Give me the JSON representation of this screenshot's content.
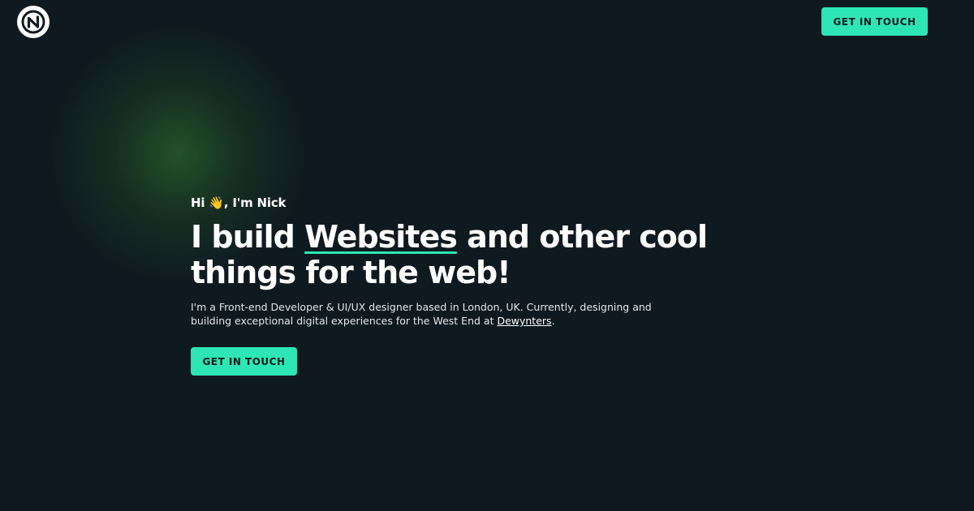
{
  "header": {
    "logo_letter": "N",
    "cta_label": "GET IN TOUCH"
  },
  "hero": {
    "greeting_prefix": "Hi",
    "greeting_emoji": "👋",
    "greeting_suffix": ", I'm Nick",
    "headline_pre": "I build ",
    "headline_highlight": "Websites",
    "headline_post": " and other cool things for the web!",
    "intro_text": "I'm a Front-end Developer & UI/UX designer based in London, UK. Currently, designing and building exceptional digital experiences for the West End at ",
    "intro_link": "Dewynters",
    "intro_end": ".",
    "cta_label": "GET IN TOUCH"
  },
  "colors": {
    "background": "#0f1a20",
    "accent": "#2ee6b5",
    "text": "#ffffff"
  }
}
